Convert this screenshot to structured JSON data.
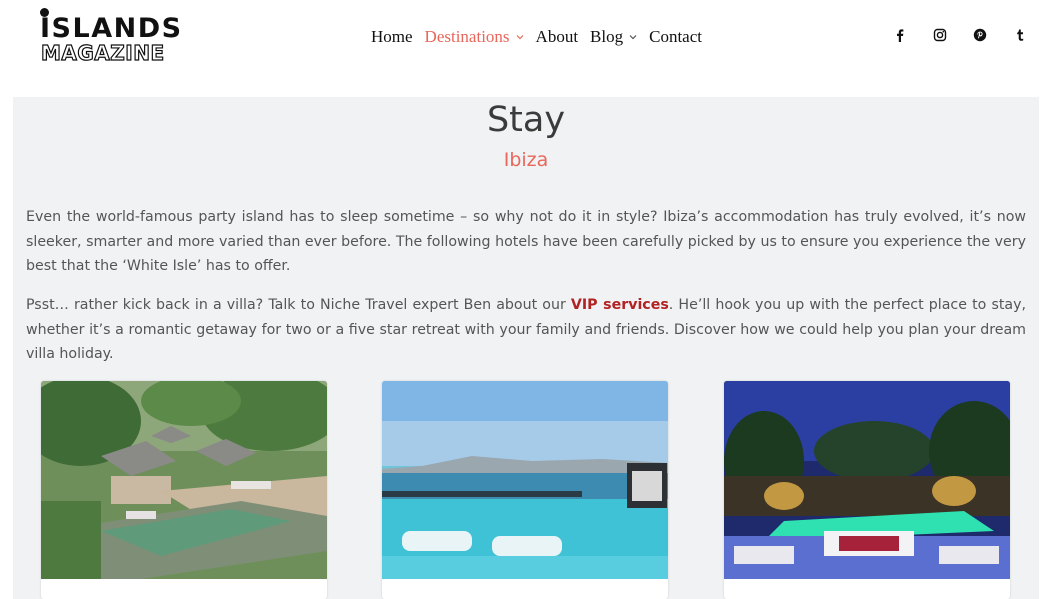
{
  "logo": {
    "line1": "ISLANDS",
    "line2": "MAGAZINE"
  },
  "nav": {
    "items": [
      {
        "label": "Home"
      },
      {
        "label": "Destinations"
      },
      {
        "label": "About"
      },
      {
        "label": "Blog"
      },
      {
        "label": "Contact"
      }
    ]
  },
  "social": [
    "facebook-icon",
    "instagram-icon",
    "pinterest-icon",
    "tumblr-icon"
  ],
  "colors": {
    "accent": "#e8675a",
    "link": "#b22222",
    "panel_bg": "#f1f2f4"
  },
  "page": {
    "title": "Stay",
    "subtitle": "Ibiza",
    "paragraph1": "Even the world-famous party island has to sleep sometime – so why not do it in style? Ibiza’s accommodation has truly evolved, it’s now sleeker, smarter and more varied than ever before. The following hotels have been carefully picked by us to ensure you experience the very best that the ‘White Isle’ has to offer.",
    "paragraph2_before": "Psst… rather kick back in a villa? Talk to Niche Travel expert Ben about our ",
    "paragraph2_link": "VIP services",
    "paragraph2_after": ". He’ll hook you up with the perfect place to stay, whether it’s a romantic getaway for two or a five star retreat with your family and friends. Discover how we could help you plan your dream villa holiday."
  }
}
